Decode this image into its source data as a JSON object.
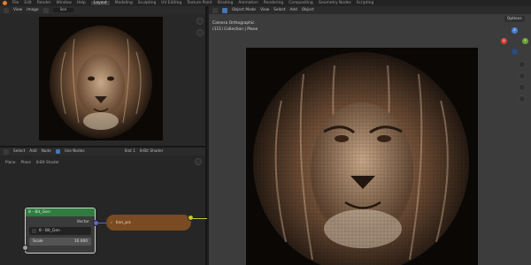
{
  "menubar": {
    "items": [
      "File",
      "Edit",
      "Render",
      "Window",
      "Help"
    ],
    "tabs": [
      "Layout",
      "Modeling",
      "Sculpting",
      "UV Editing",
      "Texture Paint",
      "Shading",
      "Animation",
      "Rendering",
      "Compositing",
      "Geometry Nodes",
      "Scripting"
    ],
    "active_tab": "Layout"
  },
  "image_editor": {
    "menus": [
      "View",
      "Image"
    ],
    "image_name": "lion"
  },
  "viewport": {
    "mode": "Object Mode",
    "menus": [
      "View",
      "Select",
      "Add",
      "Object"
    ],
    "camera_label": "Camera Orthographic",
    "collection_label": "(111) Collection | Plane",
    "view_options": "Options",
    "gizmo": {
      "x": "X",
      "y": "Y",
      "z": "Z"
    }
  },
  "node_editor": {
    "menus": [
      "Select",
      "Add",
      "Node"
    ],
    "use_nodes_label": "Use Nodes",
    "slot": "Slot 1",
    "material": "8-Bit Shader",
    "breadcrumb": [
      "Plane",
      "Plane",
      "8-Bit Shader"
    ],
    "group_node": {
      "title": "8 - Bit_Gen",
      "output": "Vector",
      "datablock": "8 - Bit_Gen",
      "scale_label": "Scale",
      "scale_value": "10.000"
    },
    "image_node": {
      "title": "lion_pic"
    }
  },
  "colors": {
    "accent_orange": "#e77c2c",
    "group_header": "#2e7d3f",
    "image_node": "#7a4a22",
    "selected_blue": "#4675b8"
  }
}
